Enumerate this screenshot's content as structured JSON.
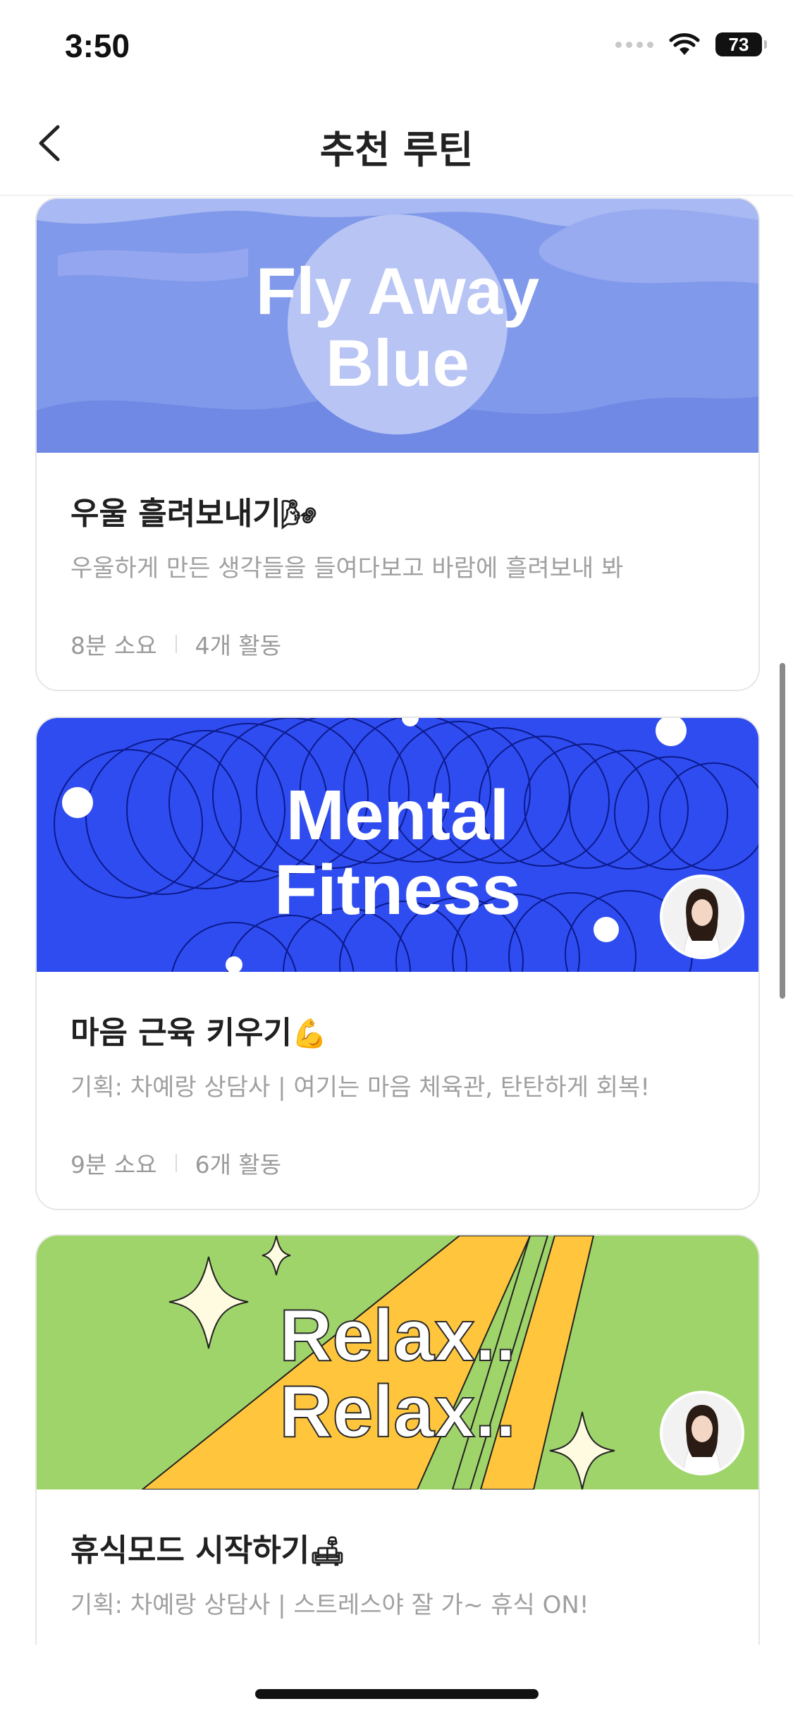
{
  "status": {
    "time": "3:50",
    "battery": "73"
  },
  "nav": {
    "title": "추천 루틴"
  },
  "cards": [
    {
      "banner_lines": [
        "Fly Away",
        "Blue"
      ],
      "title": "우울 흘려보내기",
      "title_emoji": "🌬",
      "description": "우울하게 만든 생각들을 들여다보고 바람에 흘려보내 봐",
      "duration": "8분 소요",
      "activities": "4개 활동",
      "banner_color": "#8199ea"
    },
    {
      "banner_lines": [
        "Mental",
        "Fitness"
      ],
      "title": "마음 근육 키우기",
      "title_emoji": "💪",
      "description": "기획: 차예랑 상담사 | 여기는 마음 체육관, 탄탄하게 회복!",
      "duration": "9분 소요",
      "activities": "6개 활동",
      "banner_color": "#2f4cf0"
    },
    {
      "banner_lines": [
        "Relax..",
        "Relax.."
      ],
      "title": "휴식모드 시작하기",
      "title_emoji": "🛋",
      "description": "기획: 차예랑 상담사 | 스트레스야 잘 가~ 휴식 ON!",
      "banner_color": "#9fd46a"
    }
  ]
}
